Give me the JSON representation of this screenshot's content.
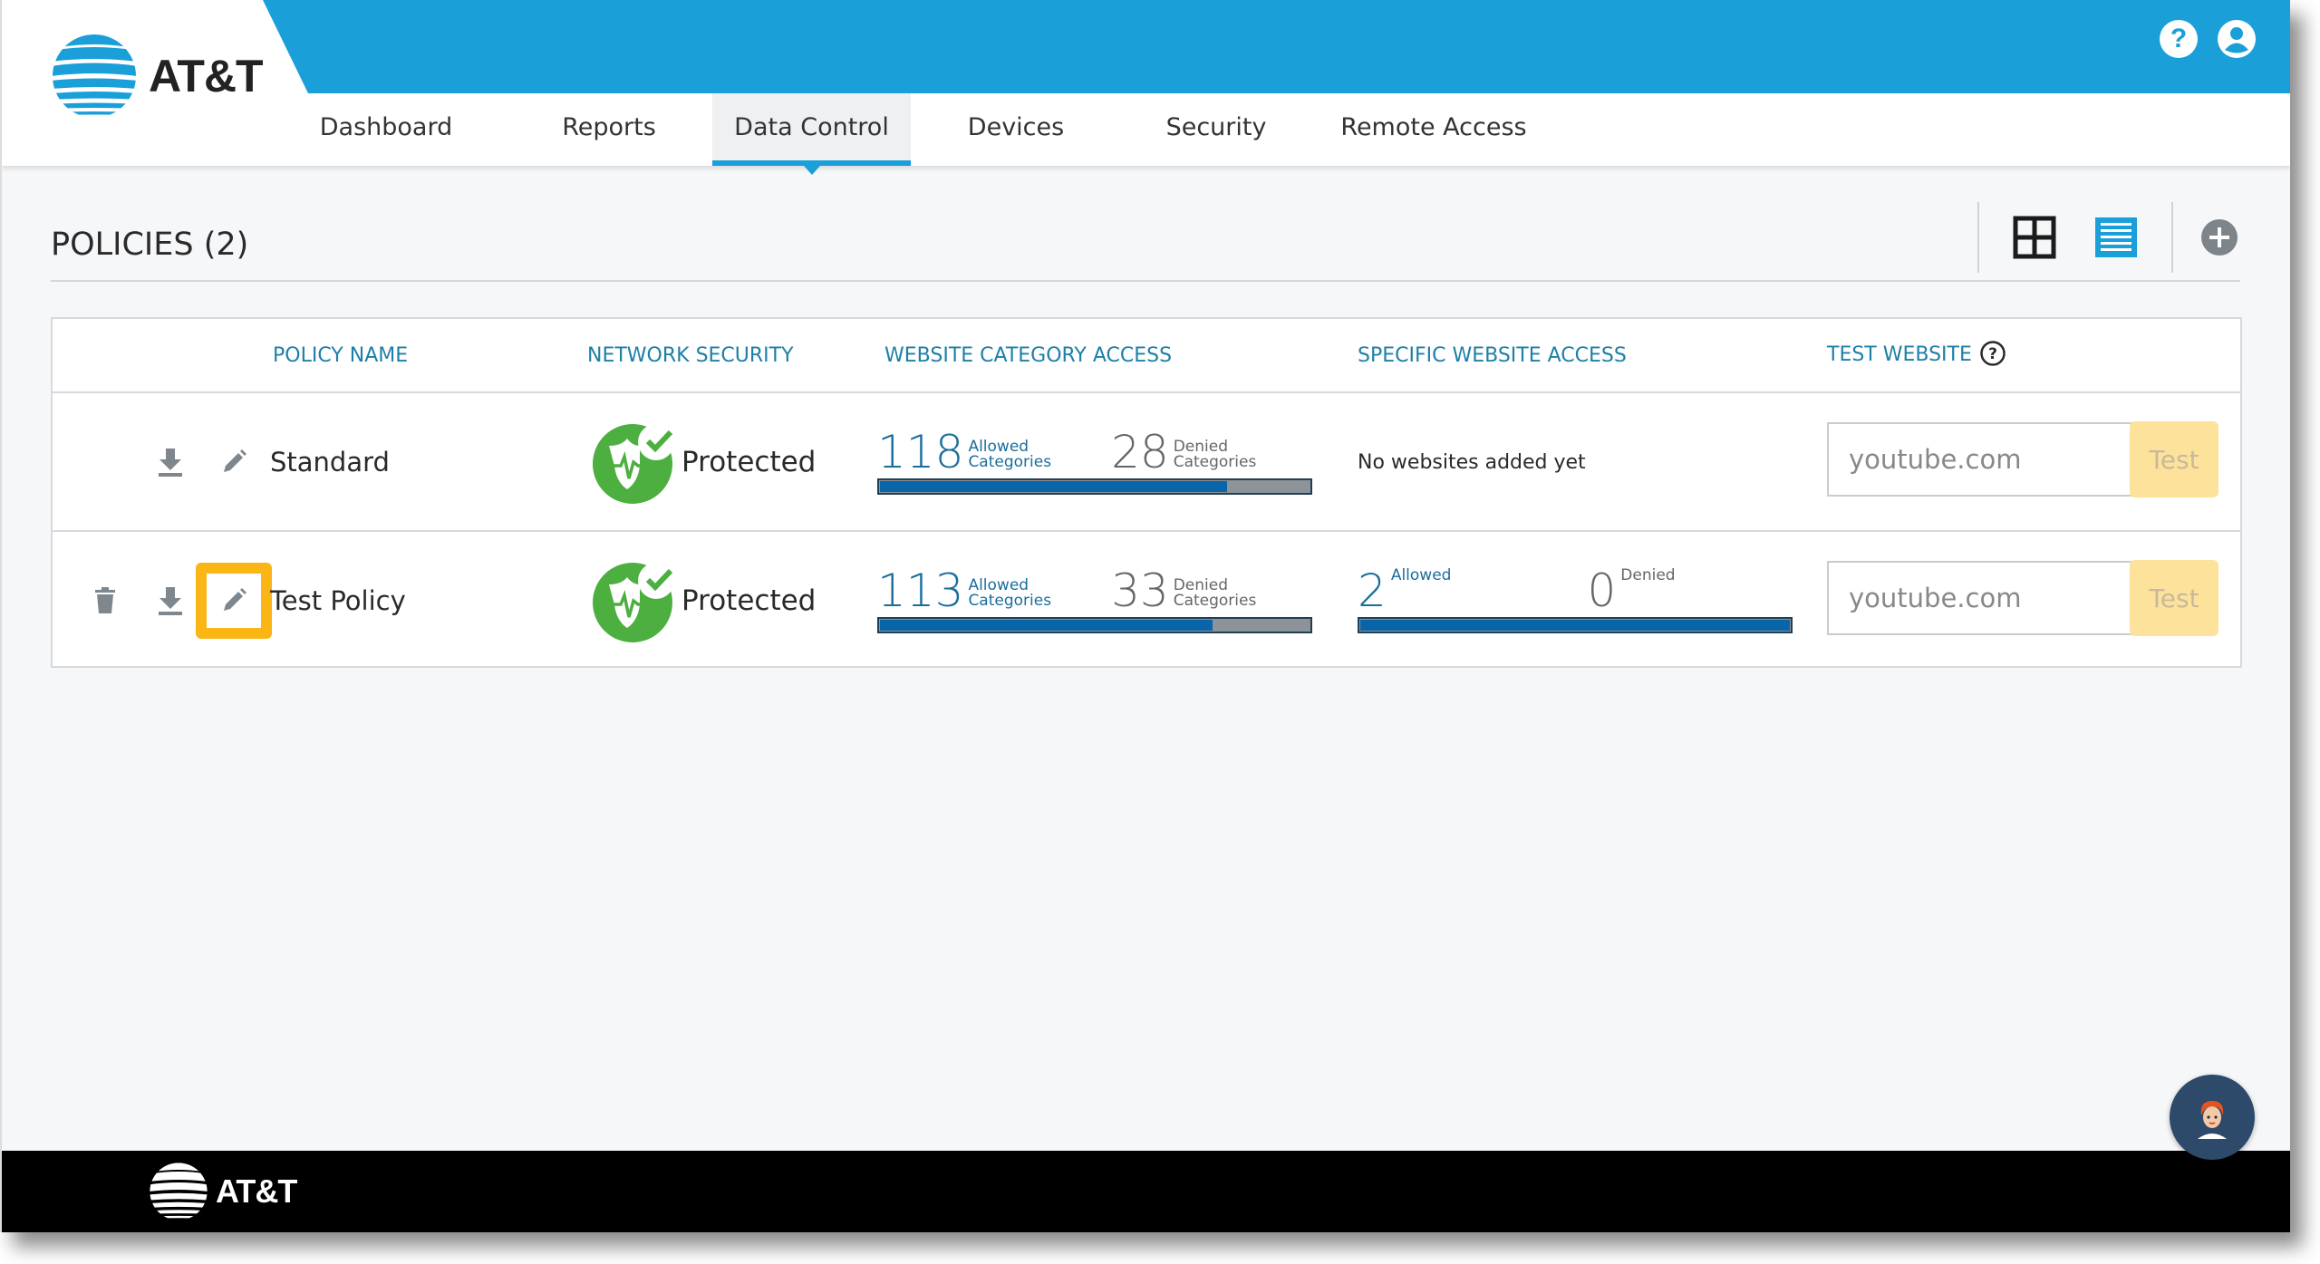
{
  "brand": {
    "name": "AT&T",
    "header_color": "#1a9fd9",
    "accent_color": "#fbb515"
  },
  "header": {
    "icons": [
      {
        "name": "help-icon",
        "glyph": "?"
      },
      {
        "name": "account-icon",
        "glyph": "user"
      }
    ]
  },
  "nav": {
    "items": [
      {
        "label": "Dashboard",
        "active": false
      },
      {
        "label": "Reports",
        "active": false
      },
      {
        "label": "Data Control",
        "active": true
      },
      {
        "label": "Devices",
        "active": false
      },
      {
        "label": "Security",
        "active": false
      },
      {
        "label": "Remote Access",
        "active": false
      }
    ]
  },
  "policies": {
    "title": "POLICIES (2)",
    "view_tools": [
      "grid-view-icon",
      "list-view-icon",
      "add-policy-icon"
    ],
    "active_view": "list"
  },
  "table": {
    "headers": {
      "policy_name": "POLICY NAME",
      "network_security": "NETWORK SECURITY",
      "website_category_access": "WEBSITE CATEGORY ACCESS",
      "specific_website_access": "SPECIFIC WEBSITE ACCESS",
      "test_website": "TEST WEBSITE"
    },
    "rows": [
      {
        "name": "Standard",
        "deletable": false,
        "network_security": "Protected",
        "categories": {
          "allowed": "118",
          "allowed_label_1": "Allowed",
          "allowed_label_2": "Categories",
          "denied": "28",
          "denied_label_1": "Denied",
          "denied_label_2": "Categories",
          "allowed_fraction": 0.808
        },
        "specific": {
          "empty_text": "No websites added yet"
        },
        "test": {
          "placeholder": "youtube.com",
          "button": "Test"
        }
      },
      {
        "name": "Test Policy",
        "deletable": true,
        "edit_highlighted": true,
        "network_security": "Protected",
        "categories": {
          "allowed": "113",
          "allowed_label_1": "Allowed",
          "allowed_label_2": "Categories",
          "denied": "33",
          "denied_label_1": "Denied",
          "denied_label_2": "Categories",
          "allowed_fraction": 0.774
        },
        "specific": {
          "allowed": "2",
          "allowed_label": "Allowed",
          "denied": "0",
          "denied_label": "Denied",
          "allowed_fraction": 1.0
        },
        "test": {
          "placeholder": "youtube.com",
          "button": "Test"
        }
      }
    ]
  },
  "footer": {
    "brand": "AT&T"
  },
  "chat": {
    "name": "chat-assistant-avatar"
  }
}
